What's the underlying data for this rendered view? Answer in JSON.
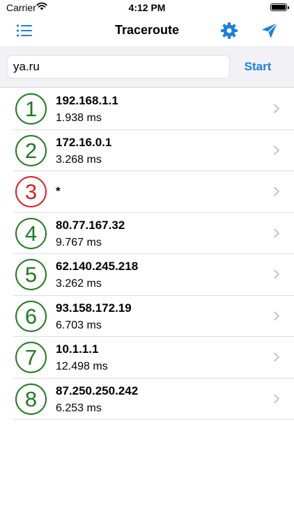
{
  "status_bar": {
    "carrier": "Carrier",
    "time": "4:12 PM"
  },
  "nav": {
    "title": "Traceroute",
    "left_icon": "list-icon",
    "right_icons": [
      "gear-icon",
      "send-icon"
    ]
  },
  "search": {
    "value": "ya.ru",
    "button_label": "Start"
  },
  "colors": {
    "accent": "#1a7fe0",
    "success": "#1e7a1e",
    "failure": "#e11d1d"
  },
  "hops": [
    {
      "number": "1",
      "host": "192.168.1.1",
      "time": "1.938 ms",
      "status": "ok"
    },
    {
      "number": "2",
      "host": "172.16.0.1",
      "time": "3.268 ms",
      "status": "ok"
    },
    {
      "number": "3",
      "host": "*",
      "time": "",
      "status": "fail"
    },
    {
      "number": "4",
      "host": "80.77.167.32",
      "time": "9.767 ms",
      "status": "ok"
    },
    {
      "number": "5",
      "host": "62.140.245.218",
      "time": "3.262 ms",
      "status": "ok"
    },
    {
      "number": "6",
      "host": "93.158.172.19",
      "time": "6.703 ms",
      "status": "ok"
    },
    {
      "number": "7",
      "host": "10.1.1.1",
      "time": "12.498 ms",
      "status": "ok"
    },
    {
      "number": "8",
      "host": "87.250.250.242",
      "time": "6.253 ms",
      "status": "ok"
    }
  ]
}
